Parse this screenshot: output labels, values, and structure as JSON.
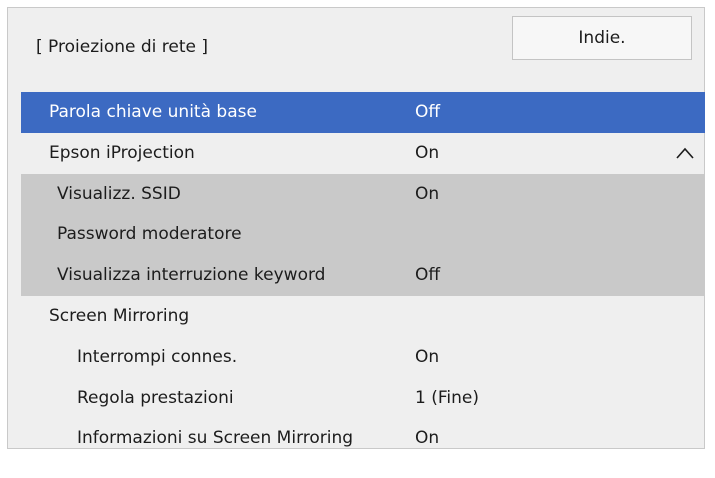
{
  "header": {
    "title": "[ Proiezione di rete ]",
    "back_label": "Indie."
  },
  "menu": {
    "items": [
      {
        "label": "Parola chiave unità base",
        "value": "Off"
      },
      {
        "label": "Epson iProjection",
        "value": "On"
      },
      {
        "label": "Visualizz. SSID",
        "value": "On"
      },
      {
        "label": "Password moderatore",
        "value": ""
      },
      {
        "label": "Visualizza interruzione keyword",
        "value": "Off"
      },
      {
        "label": "Screen Mirroring",
        "value": ""
      },
      {
        "label": "Interrompi connes.",
        "value": "On"
      },
      {
        "label": "Regola prestazioni",
        "value": "1 (Fine)"
      },
      {
        "label": "Informazioni su Screen Mirroring",
        "value": "On"
      }
    ],
    "selected_index": 0,
    "expanded_section_icon": "chevron-up-icon"
  },
  "colors": {
    "selected_row": "#3c6ac2",
    "expanded_group": "#c9c9c9",
    "panel_background": "#efefef"
  }
}
